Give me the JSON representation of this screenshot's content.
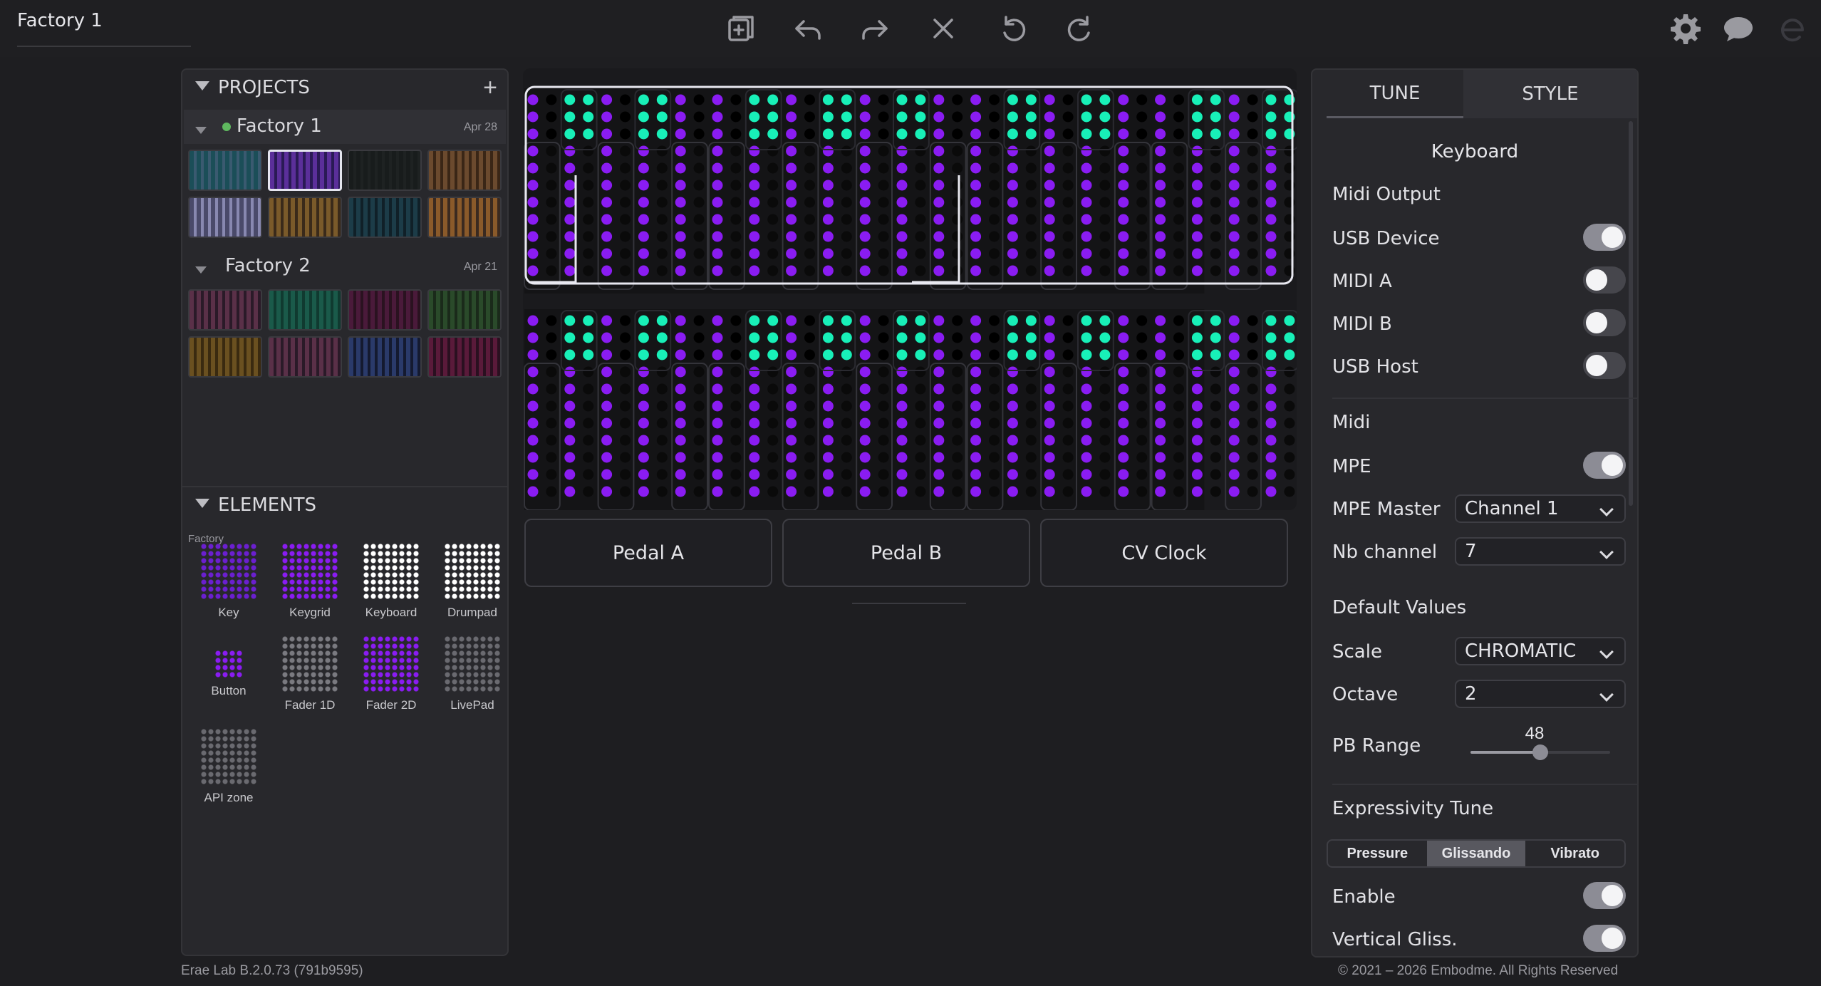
{
  "app": {
    "title": "Factory 1"
  },
  "toolbar": {
    "icons": [
      "duplicate-icon",
      "undo-icon",
      "redo-icon",
      "close-icon",
      "rotate-left-icon",
      "rotate-right-icon"
    ]
  },
  "top_right": {
    "icons": [
      "gear-icon",
      "chat-icon",
      "logo-icon"
    ]
  },
  "projects": {
    "header": "PROJECTS",
    "add_icon": "plus-icon",
    "items": [
      {
        "name": "Factory 1",
        "date": "Apr 28",
        "status": "active"
      },
      {
        "name": "Factory 2",
        "date": "Apr 21"
      }
    ]
  },
  "elements": {
    "header": "ELEMENTS",
    "group": "Factory",
    "items": [
      "Key",
      "Keygrid",
      "Keyboard",
      "Drumpad",
      "Button",
      "Fader 1D",
      "Fader 2D",
      "LivePad",
      "API zone"
    ]
  },
  "pads": [
    "Pedal A",
    "Pedal B",
    "CV Clock"
  ],
  "tune": {
    "tabs": [
      "TUNE",
      "STYLE"
    ],
    "active_tab": "TUNE",
    "section_title": "Keyboard",
    "midi_output": {
      "label": "Midi Output",
      "rows": [
        {
          "label": "USB Device",
          "on": true
        },
        {
          "label": "MIDI A",
          "on": false
        },
        {
          "label": "MIDI B",
          "on": false
        },
        {
          "label": "USB Host",
          "on": false
        }
      ]
    },
    "midi": {
      "label": "Midi",
      "mpe": {
        "label": "MPE",
        "on": true
      },
      "mpe_master": {
        "label": "MPE Master",
        "value": "Channel 1"
      },
      "nb_channel": {
        "label": "Nb channel",
        "value": "7"
      }
    },
    "defaults": {
      "label": "Default Values",
      "scale": {
        "label": "Scale",
        "value": "CHROMATIC"
      },
      "octave": {
        "label": "Octave",
        "value": "2"
      },
      "pb_range": {
        "label": "PB Range",
        "value": "48",
        "fraction": 0.5
      }
    },
    "expressivity": {
      "label": "Expressivity Tune",
      "segments": [
        "Pressure",
        "Glissando",
        "Vibrato"
      ],
      "active": "Glissando",
      "enable": {
        "label": "Enable",
        "on": true
      },
      "vertical_gliss": {
        "label": "Vertical Gliss.",
        "on": true
      }
    }
  },
  "colors": {
    "accent_purple": "#8a1cf2",
    "accent_teal": "#18f0b8",
    "bg": "#1e1e21"
  },
  "footer": {
    "version": "Erae Lab B.2.0.73 (791b9595)",
    "copyright": "© 2021 – 2026 Embodme. All Rights Reserved"
  }
}
